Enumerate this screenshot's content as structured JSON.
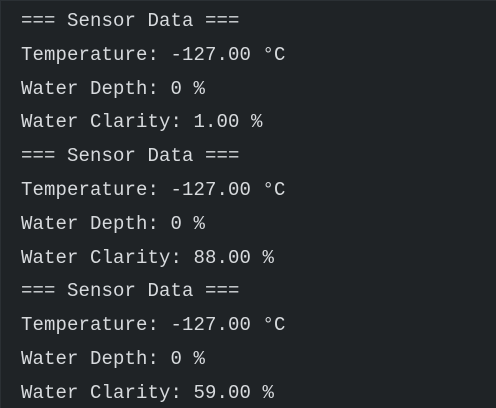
{
  "console": {
    "lines": [
      "=== Sensor Data ===",
      "Temperature: -127.00 °C",
      "Water Depth: 0 %",
      "Water Clarity: 1.00 %",
      "=== Sensor Data ===",
      "Temperature: -127.00 °C",
      "Water Depth: 0 %",
      "Water Clarity: 88.00 %",
      "=== Sensor Data ===",
      "Temperature: -127.00 °C",
      "Water Depth: 0 %",
      "Water Clarity: 59.00 %"
    ]
  },
  "colors": {
    "background": "#1f2326",
    "text": "#d7dadd"
  }
}
